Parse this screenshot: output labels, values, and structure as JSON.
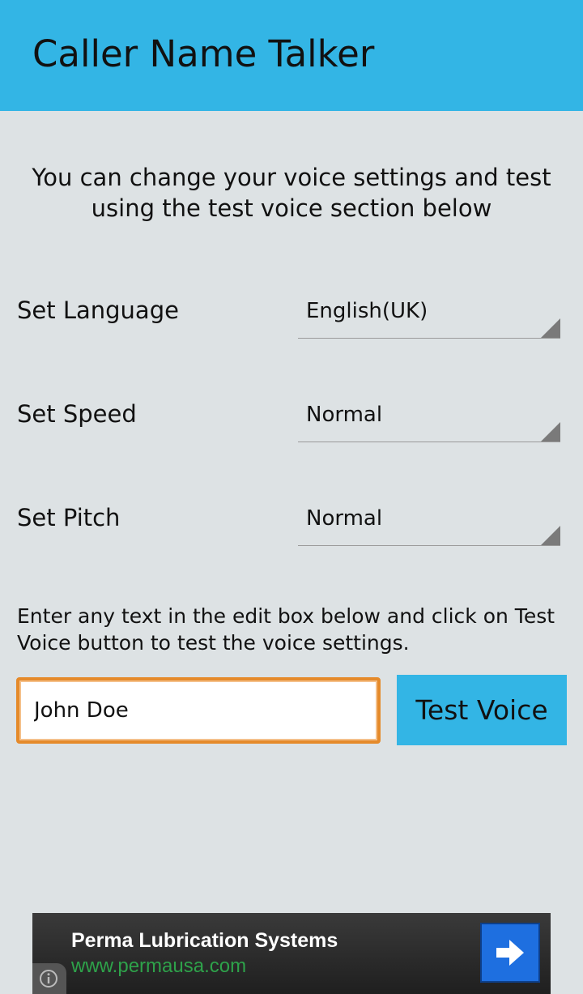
{
  "app_bar": {
    "title": "Caller Name Talker",
    "color": "#33b5e5"
  },
  "intro_text": "You can change your voice settings and test using the test voice section below",
  "settings": [
    {
      "label": "Set Language",
      "value": "English(UK)"
    },
    {
      "label": "Set Speed",
      "value": "Normal"
    },
    {
      "label": "Set Pitch",
      "value": "Normal"
    }
  ],
  "hint_text": "Enter any text in the edit box below and click on Test Voice button to test the voice settings.",
  "test_input": {
    "value": "John Doe"
  },
  "test_button": {
    "label": "Test Voice"
  },
  "ad": {
    "title": "Perma Lubrication Systems",
    "url": "www.permausa.com",
    "url_color": "#2ea24a",
    "go_icon": "arrow-right-icon",
    "info_icon": "info-icon"
  }
}
